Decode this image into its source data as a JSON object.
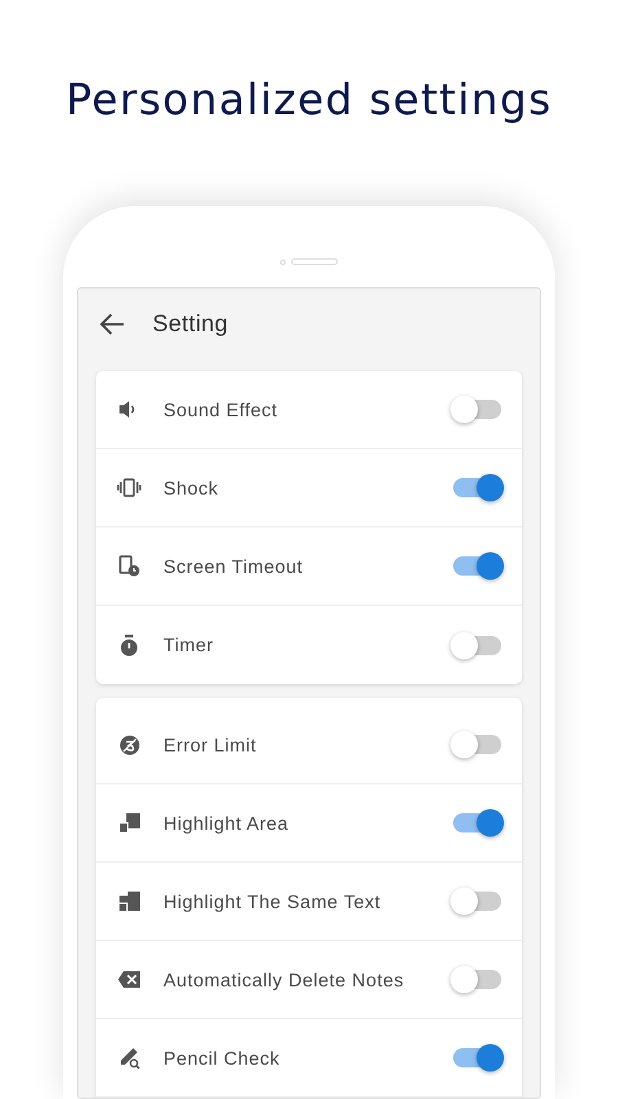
{
  "headline": "Personalized settings",
  "app_bar": {
    "title": "Setting"
  },
  "sections": [
    {
      "items": [
        {
          "label": "Sound Effect",
          "on": false
        },
        {
          "label": "Shock",
          "on": true
        },
        {
          "label": "Screen Timeout",
          "on": true
        },
        {
          "label": "Timer",
          "on": false
        }
      ]
    },
    {
      "items": [
        {
          "label": "Error Limit",
          "on": false
        },
        {
          "label": "Highlight Area",
          "on": true
        },
        {
          "label": "Highlight The Same Text",
          "on": false
        },
        {
          "label": "Automatically Delete Notes",
          "on": false
        },
        {
          "label": "Pencil Check",
          "on": true
        }
      ]
    }
  ]
}
